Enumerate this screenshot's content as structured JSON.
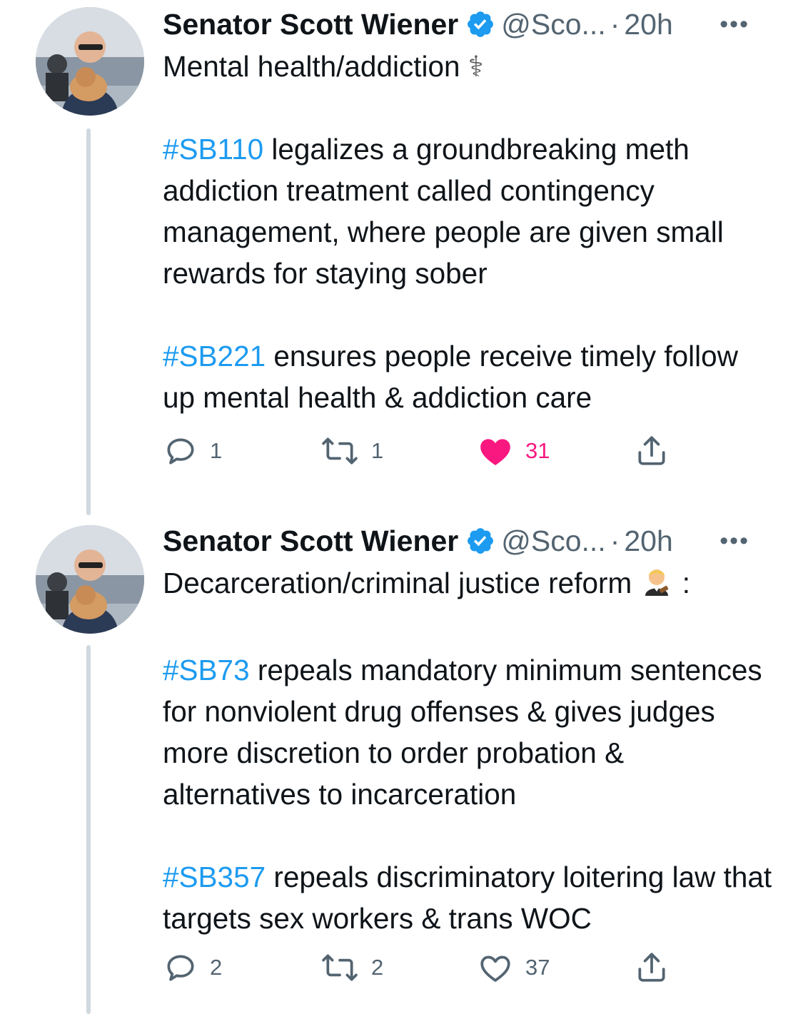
{
  "tweets": [
    {
      "name": "Senator Scott Wiener",
      "handle": "@Sco...",
      "separator": "·",
      "time": "20h",
      "more": "•••",
      "first_line": "Mental health/addiction",
      "first_emoji": "⚕",
      "p1_tag": "#SB110",
      "p1_text": " legalizes a groundbreaking meth addiction treatment called contingency management, where people are given small rewards for staying sober",
      "p2_tag": "#SB221",
      "p2_text": " ensures people receive timely follow up mental health & addiction care",
      "replies": "1",
      "retweets": "1",
      "likes": "31",
      "liked": true
    },
    {
      "name": "Senator Scott Wiener",
      "handle": "@Sco...",
      "separator": "·",
      "time": "20h",
      "more": "•••",
      "first_line": "Decarceration/criminal justice reform",
      "first_emoji": "judge-emoji",
      "first_line_suffix": ":",
      "p1_tag": "#SB73",
      "p1_text": " repeals mandatory minimum sentences for nonviolent drug offenses & gives judges more discretion to order probation & alternatives to incarceration",
      "p2_tag": "#SB357",
      "p2_text": " repeals discriminatory loitering law that targets sex workers & trans WOC",
      "replies": "2",
      "retweets": "2",
      "likes": "37",
      "liked": false
    }
  ],
  "colors": {
    "accent": "#1d9bf0",
    "like": "#f91880",
    "secondary_text": "#536471",
    "thread_line": "#cfd9de"
  }
}
